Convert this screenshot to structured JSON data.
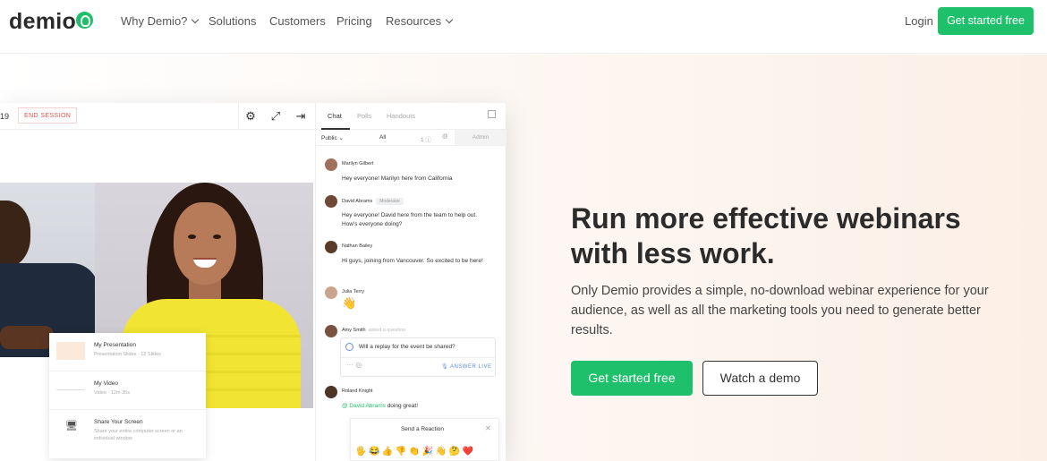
{
  "brand": {
    "logo_text": "demio",
    "accent": "#1ec06b"
  },
  "nav": {
    "links": [
      "Why Demio?",
      "Solutions",
      "Customers",
      "Pricing",
      "Resources"
    ],
    "login": "Login",
    "cta": "Get started free"
  },
  "app": {
    "timer": "19",
    "end_session": "END SESSION",
    "content_items": [
      {
        "title": "My Presentation",
        "subtitle": "Presentation Slides · 12 Slides"
      },
      {
        "title": "My Video",
        "subtitle": "Video · 12m 35s"
      },
      {
        "title": "Share Your Screen",
        "subtitle": "Share your entire computer screen or an individual window"
      }
    ],
    "chat": {
      "tabs": [
        "Chat",
        "Polls",
        "Handouts"
      ],
      "filter": {
        "public": "Public",
        "all": "All",
        "count": "1",
        "admin": "Admin"
      },
      "messages": [
        {
          "name": "Marilyn Gilbert",
          "text": "Hey everyone! Marilyn here from California"
        },
        {
          "name": "David Abrams",
          "badge": "Moderator",
          "text": "Hey everyone! David here from the team to help out. How's everyone doing?"
        },
        {
          "name": "Nathan Bailey",
          "text": "Hi guys, joining from Vancouver. So excited to be here!"
        },
        {
          "name": "Julia Terry",
          "text": "👋"
        },
        {
          "name": "Amy Smith",
          "asked": "asked a question",
          "text": ""
        },
        {
          "name": "Roland Knight",
          "mention": "@ David Abrams",
          "text": "doing great!"
        }
      ],
      "question": {
        "text": "Will a replay for the event be shared?",
        "answer": "ANSWER LIVE"
      },
      "reaction": {
        "title": "Send a Reaction",
        "emojis": "🖐😂👍👎👏🎉👋🤔❤️"
      }
    }
  },
  "hero": {
    "headline": "Run more effective webinars with less work.",
    "subcopy": "Only Demio provides a simple, no-download webinar experience for your audience, as well as all the marketing tools you need to generate better results.",
    "cta_primary": "Get started free",
    "cta_secondary": "Watch a demo"
  }
}
